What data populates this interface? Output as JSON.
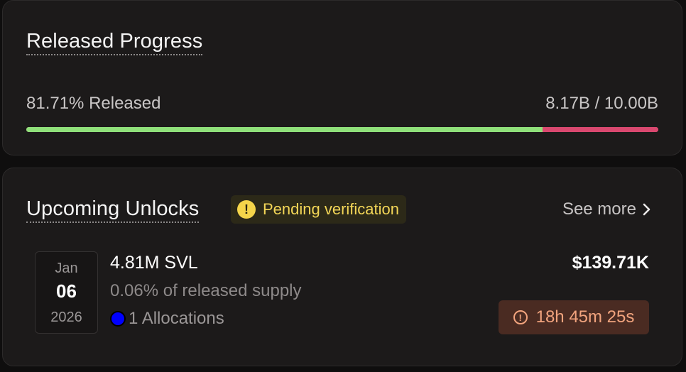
{
  "progress": {
    "title": "Released Progress",
    "released_label": "81.71% Released",
    "released_fraction": 0.8171,
    "amount_label": "8.17B / 10.00B",
    "colors": {
      "released": "#8fe07a",
      "remaining": "#d9486f"
    }
  },
  "unlocks": {
    "title": "Upcoming Unlocks",
    "badge": {
      "icon": "warning-icon",
      "label": "Pending verification",
      "color": "#f3d657"
    },
    "see_more_label": "See more",
    "items": [
      {
        "date": {
          "month": "Jan",
          "day": "06",
          "year": "2026"
        },
        "amount": "4.81M SVL",
        "supply": "0.06% of released supply",
        "allocations": "1 Allocations",
        "allocation_color": "#0000ff",
        "value": "$139.71K",
        "countdown": "18h 45m 25s",
        "countdown_icon": "clock-icon"
      }
    ]
  }
}
